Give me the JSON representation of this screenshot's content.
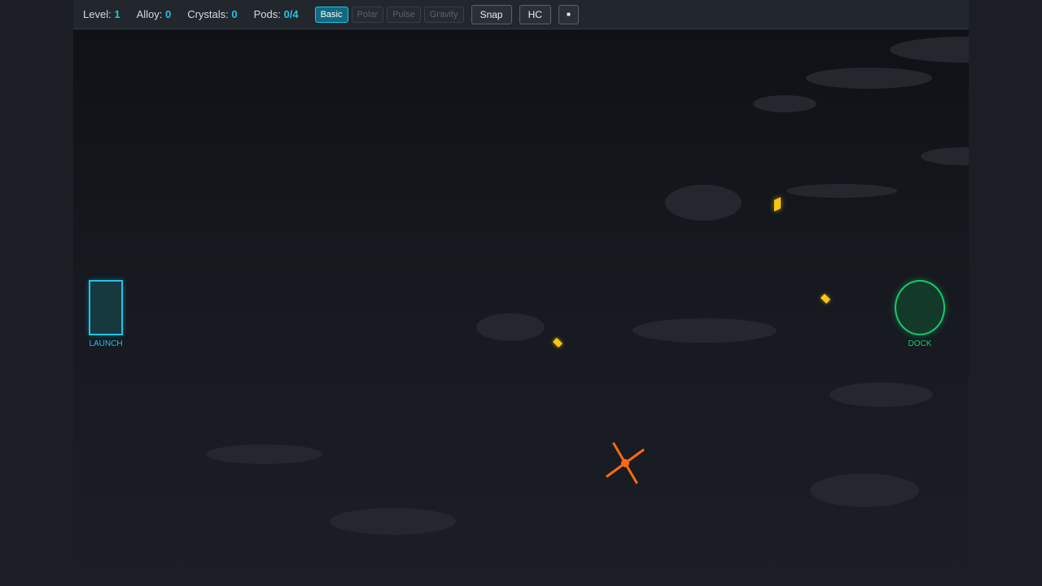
{
  "hud": {
    "level_label": "Level:",
    "level_value": "1",
    "alloy_label": "Alloy:",
    "alloy_value": "0",
    "crystals_label": "Crystals:",
    "crystals_value": "0",
    "pods_label": "Pods:",
    "pods_value": "0/4"
  },
  "tools": {
    "basic": "Basic",
    "polar": "Polar",
    "pulse": "Pulse",
    "gravity": "Gravity",
    "selected": "Basic"
  },
  "actions": {
    "snap": "Snap",
    "hc": "HC",
    "pause_glyph": "■"
  },
  "field": {
    "launch_label": "LAUNCH",
    "dock_label": "DOCK"
  },
  "colors": {
    "accent": "#22c4e8",
    "launch": "#1fc3e6",
    "dock": "#19c86a",
    "crystal": "#f7c614",
    "hazard": "#ff6a10"
  },
  "icons": {
    "crystal": "crystal-icon",
    "hazard": "spinning-hazard-icon"
  }
}
